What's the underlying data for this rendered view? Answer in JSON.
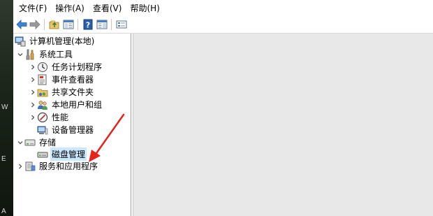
{
  "menubar": {
    "items": [
      {
        "label": "文件(F)"
      },
      {
        "label": "操作(A)"
      },
      {
        "label": "查看(V)"
      },
      {
        "label": "帮助(H)"
      }
    ]
  },
  "toolbar": {
    "buttons": [
      {
        "icon": "back-arrow-icon"
      },
      {
        "icon": "forward-arrow-icon"
      },
      {
        "icon": "up-folder-icon"
      },
      {
        "icon": "show-hide-tree-icon"
      },
      {
        "icon": "help-icon"
      },
      {
        "icon": "show-action-pane-icon"
      },
      {
        "icon": "properties-icon"
      }
    ]
  },
  "desktop_strip": {
    "glyphs": [
      "W",
      "E",
      "A"
    ]
  },
  "tree": {
    "root": {
      "label": "计算机管理(本地)",
      "icon": "computer-management-icon"
    },
    "system_tools": {
      "label": "系统工具",
      "icon": "tools-icon",
      "expanded": true,
      "children": [
        {
          "label": "任务计划程序",
          "icon": "clock-icon",
          "expandable": true
        },
        {
          "label": "事件查看器",
          "icon": "event-viewer-icon",
          "expandable": true
        },
        {
          "label": "共享文件夹",
          "icon": "shared-folder-icon",
          "expandable": true
        },
        {
          "label": "本地用户和组",
          "icon": "users-icon",
          "expandable": true
        },
        {
          "label": "性能",
          "icon": "performance-icon",
          "expandable": true
        },
        {
          "label": "设备管理器",
          "icon": "device-manager-icon",
          "expandable": false
        }
      ]
    },
    "storage": {
      "label": "存储",
      "icon": "storage-icon",
      "expanded": true,
      "children": [
        {
          "label": "磁盘管理",
          "icon": "disk-icon",
          "selected": true
        }
      ]
    },
    "services": {
      "label": "服务和应用程序",
      "icon": "services-icon",
      "expandable": true
    }
  },
  "colors": {
    "selection": "#cce8ff",
    "annotation_arrow": "#e8231c",
    "content_bg": "#e8e8e8"
  }
}
